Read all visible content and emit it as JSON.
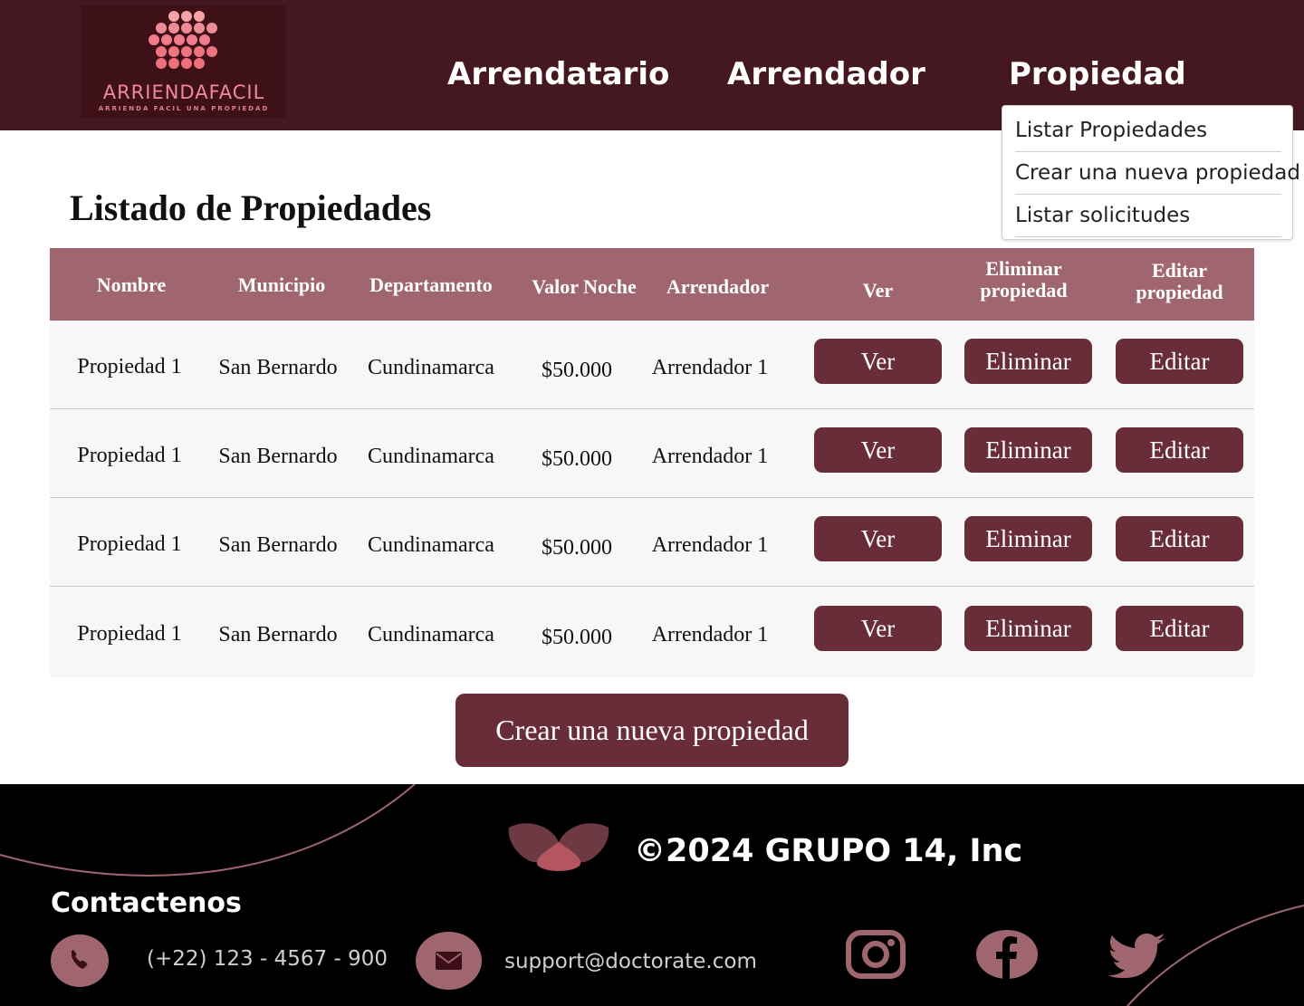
{
  "header": {
    "logo_word": "ARRIENDAFACIL",
    "logo_tagline": "ARRIENDA FACIL UNA PROPIEDAD",
    "nav": [
      {
        "label": "Arrendatario"
      },
      {
        "label": "Arrendador"
      },
      {
        "label": "Propiedad"
      }
    ],
    "dropdown": [
      {
        "label": "Listar Propiedades"
      },
      {
        "label": "Crear una nueva propiedad"
      },
      {
        "label": "Listar solicitudes"
      }
    ]
  },
  "main": {
    "title": "Listado de Propiedades",
    "columns": {
      "nombre": "Nombre",
      "municipio": "Municipio",
      "departamento": "Departamento",
      "valor": "Valor Noche",
      "arrendador": "Arrendador",
      "ver": "Ver",
      "eliminar_1": "Eliminar",
      "eliminar_2": "propiedad",
      "editar_1": "Editar",
      "editar_2": "propiedad"
    },
    "rows": [
      {
        "nombre": "Propiedad 1",
        "municipio": "San Bernardo",
        "departamento": "Cundinamarca",
        "valor": "$50.000",
        "arrendador": "Arrendador 1",
        "ver": "Ver",
        "eliminar": "Eliminar",
        "editar": "Editar"
      },
      {
        "nombre": "Propiedad 1",
        "municipio": "San Bernardo",
        "departamento": "Cundinamarca",
        "valor": "$50.000",
        "arrendador": "Arrendador 1",
        "ver": "Ver",
        "eliminar": "Eliminar",
        "editar": "Editar"
      },
      {
        "nombre": "Propiedad 1",
        "municipio": "San Bernardo",
        "departamento": "Cundinamarca",
        "valor": "$50.000",
        "arrendador": "Arrendador 1",
        "ver": "Ver",
        "eliminar": "Eliminar",
        "editar": "Editar"
      },
      {
        "nombre": "Propiedad 1",
        "municipio": "San Bernardo",
        "departamento": "Cundinamarca",
        "valor": "$50.000",
        "arrendador": "Arrendador 1",
        "ver": "Ver",
        "eliminar": "Eliminar",
        "editar": "Editar"
      }
    ],
    "create_button": "Crear una nueva propiedad"
  },
  "footer": {
    "copyright": "©2024 GRUPO 14, Inc",
    "contact_title": "Contactenos",
    "phone": "(+22) 123 - 4567 - 900",
    "email": "support@doctorate.com",
    "social": [
      {
        "icon": "instagram-icon"
      },
      {
        "icon": "facebook-icon"
      },
      {
        "icon": "twitter-icon"
      }
    ]
  },
  "colors": {
    "header_bg": "#451720",
    "table_header_bg": "#a0666f",
    "button_bg": "#692d3a",
    "footer_bg": "#000000",
    "accent": "#a0666f"
  }
}
